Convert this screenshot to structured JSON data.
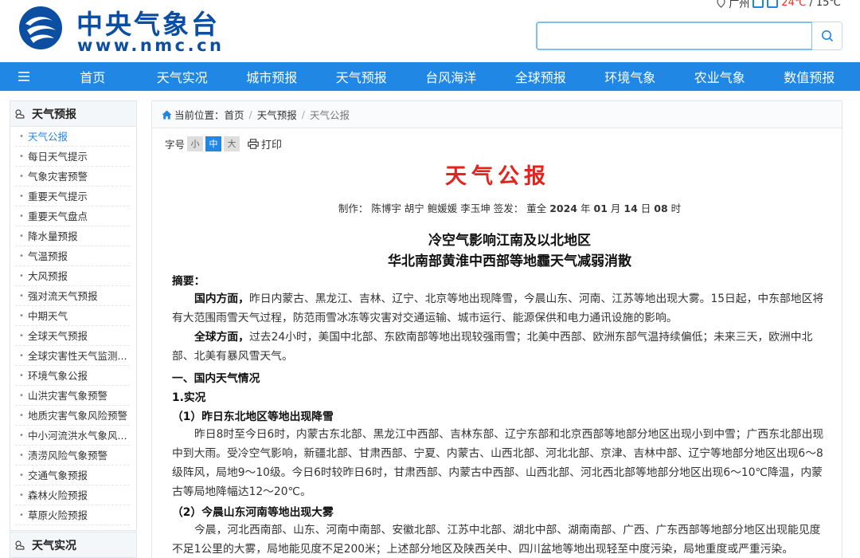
{
  "header": {
    "logo_cn": "中央气象台",
    "logo_en": "www.nmc.cn",
    "city": "广州",
    "temp_high": "24℃",
    "temp_sep": "/",
    "temp_low": "15℃",
    "search_placeholder": ""
  },
  "nav": {
    "items": [
      "首页",
      "天气实况",
      "城市预报",
      "天气预报",
      "台风海洋",
      "全球预报",
      "环境气象",
      "农业气象",
      "数值预报"
    ]
  },
  "sidebar": {
    "section1_title": "天气预报",
    "items": [
      "天气公报",
      "每日天气提示",
      "气象灾害预警",
      "重要天气提示",
      "重要天气盘点",
      "降水量预报",
      "气温预报",
      "大风预报",
      "强对流天气预报",
      "中期天气",
      "全球天气预报",
      "全球灾害性天气监测...",
      "环境气象公报",
      "山洪灾害气象预警",
      "地质灾害气象风险预警",
      "中小河流洪水气象风...",
      "渍涝风险气象预警",
      "交通气象预报",
      "森林火险预报",
      "草原火险预报"
    ],
    "section2_title": "天气实况"
  },
  "breadcrumb": {
    "label": "当前位置：",
    "home": "首页",
    "level1": "天气预报",
    "current": "天气公报"
  },
  "tools": {
    "font_label": "字号",
    "small": "小",
    "medium": "中",
    "large": "大",
    "print": "打印"
  },
  "article": {
    "title": "天气公报",
    "meta_label": "制作：",
    "authors": "陈博宇 胡宁 鲍媛媛 李玉坤",
    "signer_label": "签发：",
    "signer": "董全",
    "year": "2024",
    "year_unit": "年",
    "month": "01",
    "month_unit": "月",
    "day": "14",
    "day_unit": "日",
    "hour": "08",
    "hour_unit": "时",
    "headline1": "冷空气影响江南及以北地区",
    "headline2": "华北南部黄淮中西部等地霾天气减弱消散",
    "summary_label": "摘要：",
    "domestic_label": "国内方面，",
    "domestic_text": "昨日内蒙古、黑龙江、吉林、辽宁、北京等地出现降雪，今晨山东、河南、江苏等地出现大雾。15日起，中东部地区将有大范围雨雪天气过程，防范雨雪冰冻等灾害对交通运输、城市运行、能源保供和电力通讯设施的影响。",
    "global_label": "全球方面，",
    "global_text": "过去24小时，美国中北部、东欧南部等地出现较强雨雪；北美中西部、欧洲东部气温持续偏低；未来三天，欧洲中北部、北美有暴风雪天气。",
    "sec1": "一、国内天气情况",
    "sec1_1": "1.实况",
    "sub1": "（1）昨日东北地区等地出现降雪",
    "sub1_text": "昨日8时至今日6时，内蒙古东北部、黑龙江中西部、吉林东部、辽宁东部和北京西部等地部分地区出现小到中雪；广西东北部出现中到大雨。受冷空气影响，新疆北部、甘肃西部、宁夏、内蒙古、山西北部、河北北部、京津、吉林中部、辽宁等地部分地区出现6～8级阵风，局地9～10级。今日6时较昨日6时，甘肃西部、内蒙古中西部、山西北部、河北西北部等地部分地区出现6～10℃降温，内蒙古等局地降幅达12～20℃。",
    "sub2": "（2）今晨山东河南等地出现大雾",
    "sub2_text": "今晨，河北西南部、山东、河南中南部、安徽北部、江苏中北部、湖北中部、湖南南部、广西、广东西部等地部分地区出现能见度不足1公里的大雾，局地能见度不足200米；上述部分地区及陕西关中、四川盆地等地出现轻至中度污染，局地重度或严重污染。"
  },
  "colors": {
    "brand_blue": "#0b4ea2",
    "nav_blue": "#2187e5",
    "title_red": "#e8221b"
  }
}
